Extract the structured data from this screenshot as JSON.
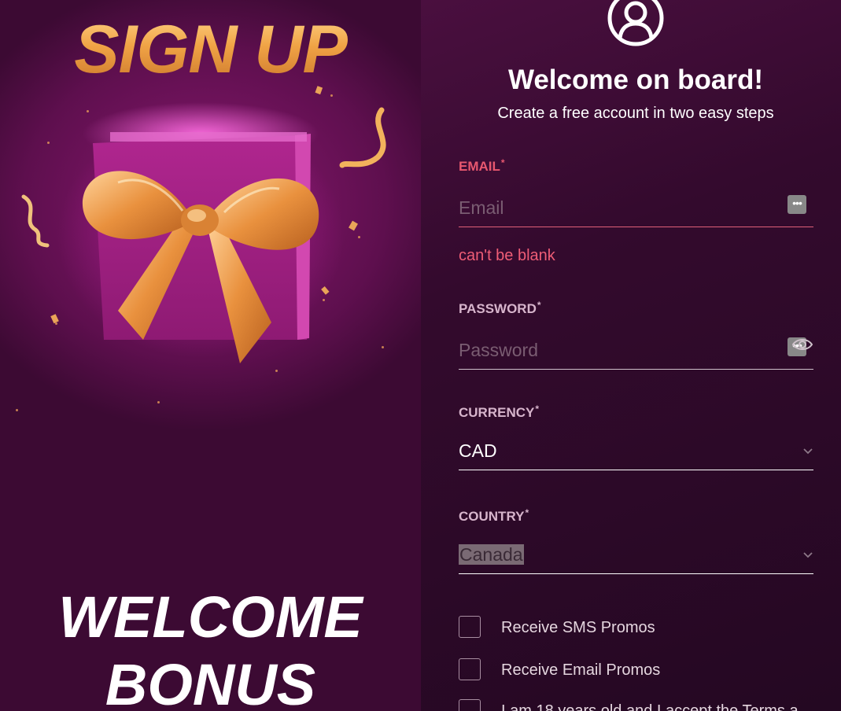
{
  "promo": {
    "title": "SIGN UP",
    "bonus_line1": "WELCOME",
    "bonus_line2": "BONUS"
  },
  "form": {
    "heading": "Welcome on board!",
    "subheading": "Create a free account in two easy steps",
    "email": {
      "label": "EMAIL",
      "required_mark": "*",
      "placeholder": "Email",
      "value": "",
      "error": "can't be blank"
    },
    "password": {
      "label": "PASSWORD",
      "required_mark": "*",
      "placeholder": "Password",
      "value": ""
    },
    "currency": {
      "label": "CURRENCY",
      "required_mark": "*",
      "value": "CAD"
    },
    "country": {
      "label": "COUNTRY",
      "required_mark": "*",
      "value": "Canada"
    },
    "checkboxes": [
      {
        "label": "Receive SMS Promos",
        "checked": false
      },
      {
        "label": "Receive Email Promos",
        "checked": false
      },
      {
        "label": "I am 18 years old and I accept the Terms a",
        "checked": false
      }
    ]
  },
  "colors": {
    "accent_gold": "#f0a345",
    "error_red": "#ef5d76",
    "label_pink": "#d7b5cc",
    "panel_dark": "#2a0a22"
  },
  "icons": [
    "user-circle-icon",
    "password-manager-icon",
    "eye-icon",
    "chevron-down-icon"
  ]
}
